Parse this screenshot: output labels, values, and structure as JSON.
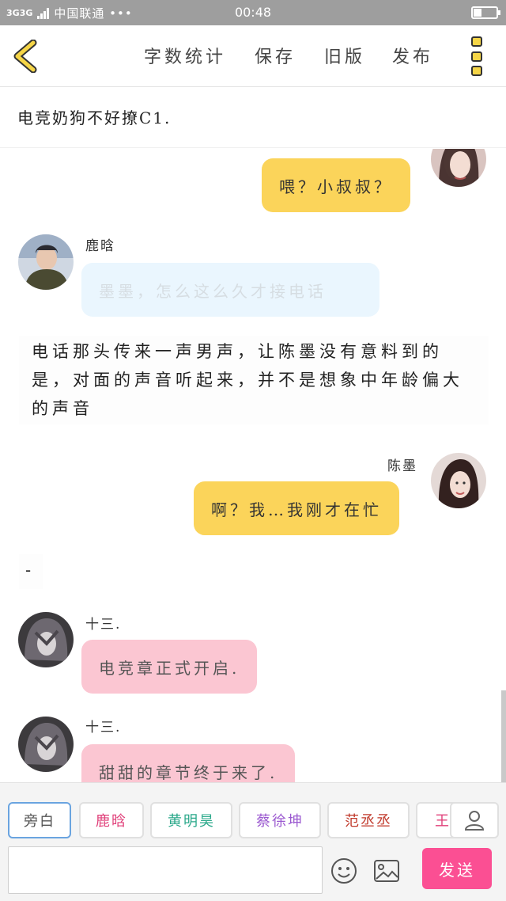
{
  "status_bar": {
    "network": "3G",
    "network2": "3G",
    "carrier": "中国联通 •••",
    "time": "00:48",
    "battery_level": 0.35
  },
  "toolbar": {
    "word_count": "字数统计",
    "save": "保存",
    "old_version": "旧版",
    "publish": "发布"
  },
  "chapter_title": "电竞奶狗不好撩C1.",
  "messages": [
    {
      "type": "right",
      "text": "喂？小叔叔？"
    },
    {
      "type": "left",
      "name": "鹿晗",
      "text": "墨墨，怎么这么久才接电话"
    },
    {
      "type": "narration",
      "text": "电话那头传来一声男声，让陈墨没有意料到的是，对面的声音听起来，并不是想象中年龄偏大的声音"
    },
    {
      "type": "right",
      "name": "陈墨",
      "text": "啊？我…我刚才在忙"
    },
    {
      "type": "narration",
      "text": "-"
    },
    {
      "type": "left",
      "name": "十三.",
      "text": "电竞章正式开启."
    },
    {
      "type": "left",
      "name": "十三.",
      "text": "甜甜的章节终于来了."
    }
  ],
  "characters": [
    {
      "label": "旁白",
      "color": "#555555"
    },
    {
      "label": "鹿晗",
      "color": "#e0407a"
    },
    {
      "label": "黄明昊",
      "color": "#2aa88a"
    },
    {
      "label": "蔡徐坤",
      "color": "#9b59d0"
    },
    {
      "label": "范丞丞",
      "color": "#c0392b"
    },
    {
      "label": "王",
      "color": "#e0407a"
    }
  ],
  "input": {
    "placeholder": ""
  },
  "send_label": "发送"
}
